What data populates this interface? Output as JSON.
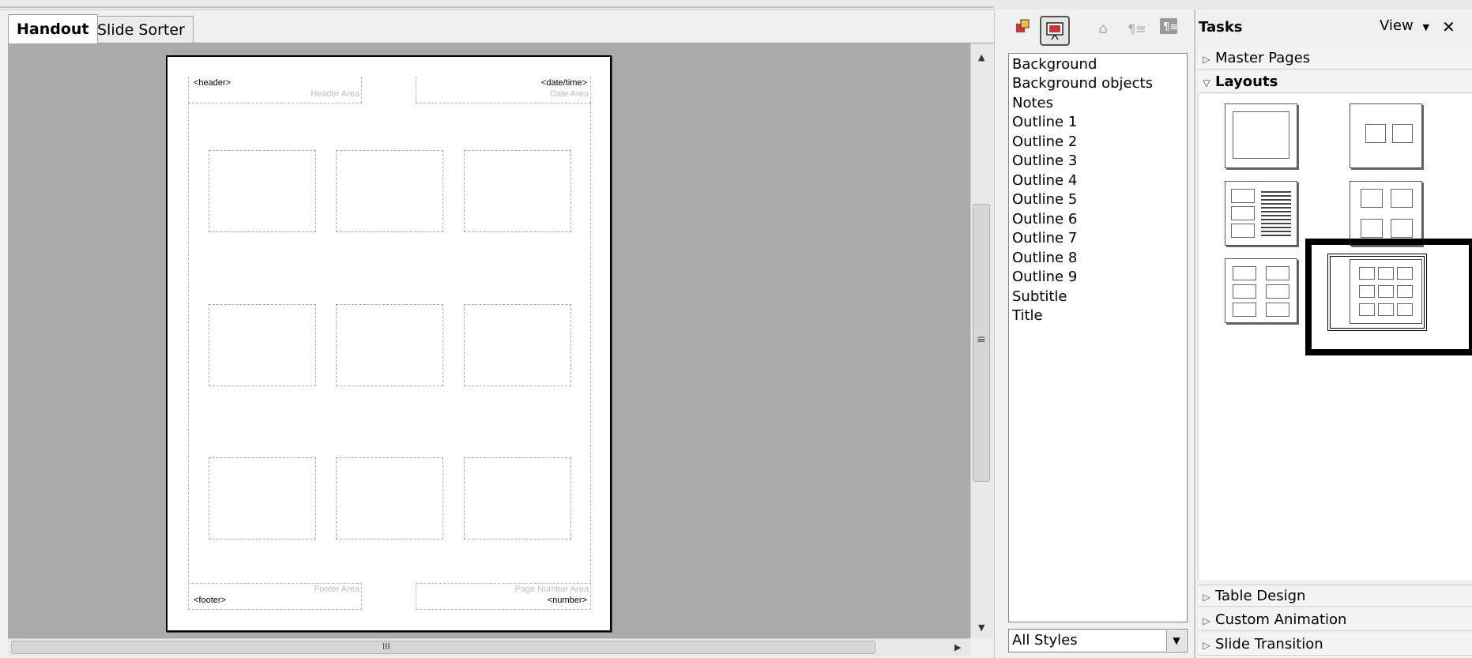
{
  "tabs": [
    {
      "label": "Handout",
      "active": true
    },
    {
      "label": "Slide Sorter",
      "active": false
    }
  ],
  "handout_page": {
    "header_field": "<header>",
    "header_area_label": "Header Area",
    "date_field": "<date/time>",
    "date_area_label": "Date Area",
    "footer_field": "<footer>",
    "footer_area_label": "Footer Area",
    "number_field": "<number>",
    "number_area_label": "Page Number Area",
    "slides_per_page": 9
  },
  "horizontal_scroll_grip": "III",
  "vertical_scroll_grip": "≡",
  "styles_panel": {
    "toolbar_icons": [
      "graphics-styles-icon",
      "presentation-styles-icon",
      "fill-format-mode-icon",
      "new-style-from-selection-icon",
      "update-style-icon"
    ],
    "styles": [
      "Background",
      "Background objects",
      "Notes",
      "Outline 1",
      "Outline 2",
      "Outline 3",
      "Outline 4",
      "Outline 5",
      "Outline 6",
      "Outline 7",
      "Outline 8",
      "Outline 9",
      "Subtitle",
      "Title"
    ],
    "filter_value": "All Styles"
  },
  "tasks_panel": {
    "title": "Tasks",
    "view_label": "View",
    "sections": {
      "master_pages": "Master Pages",
      "layouts": "Layouts",
      "table_design": "Table Design",
      "custom_animation": "Custom Animation",
      "slide_transition": "Slide Transition"
    },
    "layouts": [
      "1 slide",
      "2 slides",
      "3 slides",
      "4 slides",
      "6 slides",
      "9 slides"
    ],
    "selected_layout": "9 slides"
  }
}
